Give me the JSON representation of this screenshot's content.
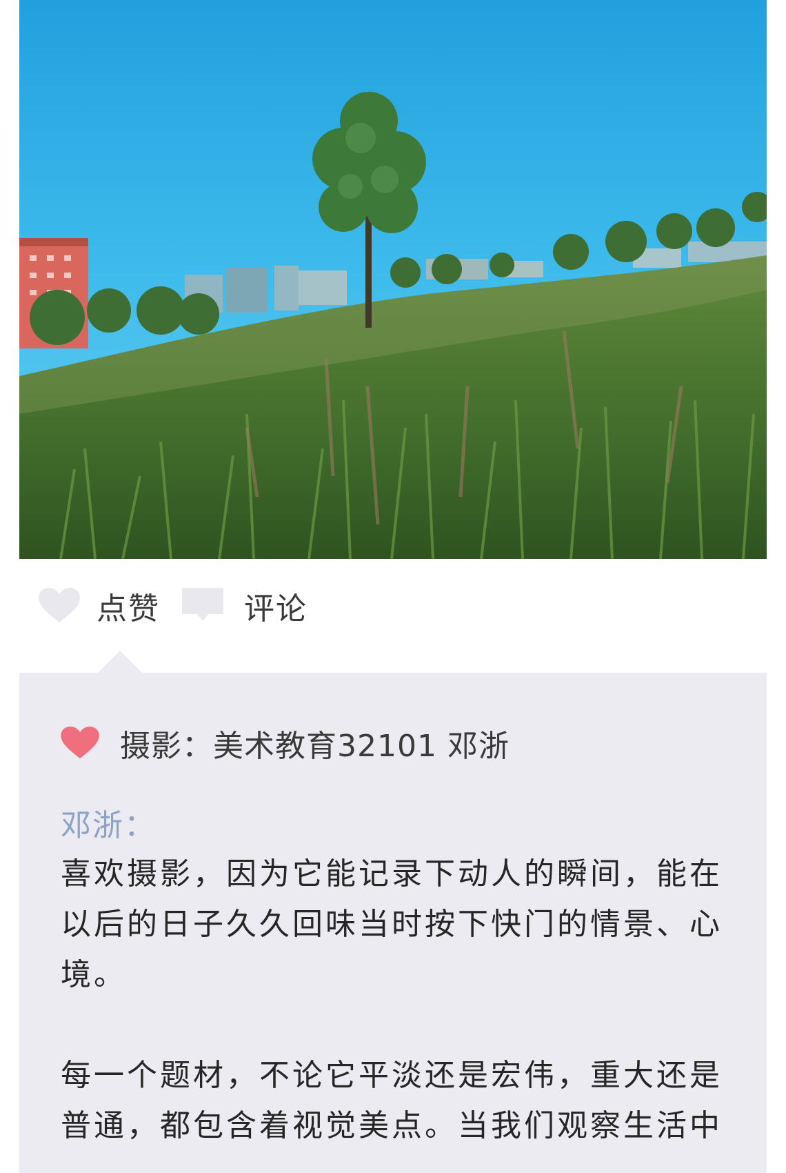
{
  "photo": {
    "description_icon": "photo-landscape-icon"
  },
  "actions": {
    "like_label": "点赞",
    "like_icon": "heart-outline-icon",
    "comment_label": "评论",
    "comment_icon": "speech-bubble-icon"
  },
  "comment_panel": {
    "credit_icon": "heart-filled-icon",
    "credit_text": "摄影：美术教育32101 邓浙",
    "author": "邓浙：",
    "paragraphs": [
      "喜欢摄影，因为它能记录下动人的瞬间，能在以后的日子久久回味当时按下快门的情景、心境。",
      "每一个题材，不论它平淡还是宏伟，重大还是普通，都包含着视觉美点。当我们观察生活中"
    ]
  },
  "colors": {
    "sky_top": "#2aa0dd",
    "sky_bottom": "#4cc8ef",
    "grass": "#4f7a36",
    "panel_bg": "#ecebf1",
    "author_color": "#8aa3c8",
    "heart_pink": "#ef6f7f",
    "icon_light": "#e9e8ee"
  }
}
